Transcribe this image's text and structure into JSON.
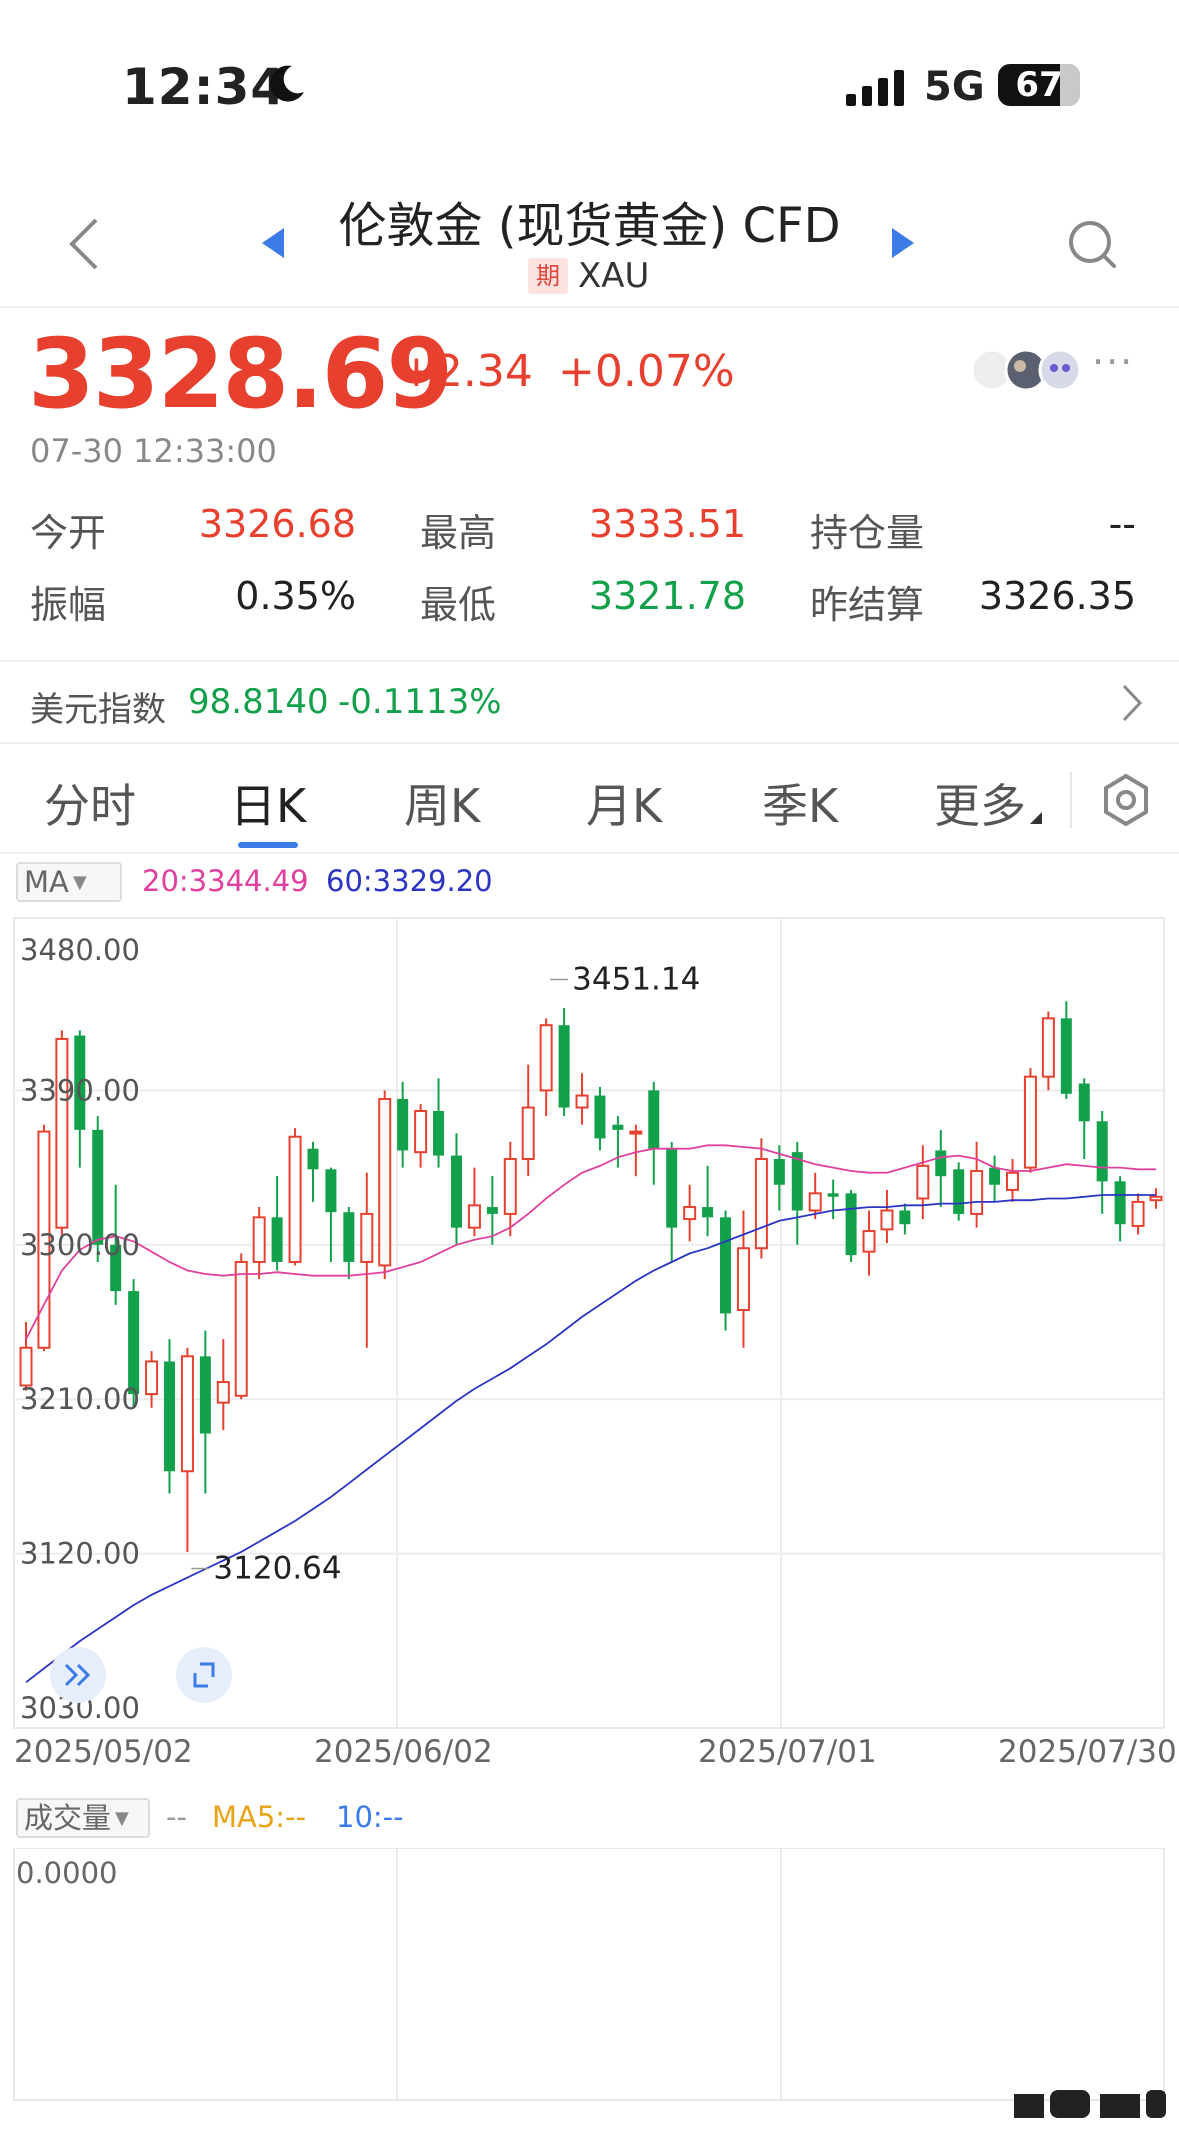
{
  "status_bar": {
    "time": "12:34",
    "network": "5G",
    "battery": "67"
  },
  "header": {
    "title": "伦敦金 (现货黄金) CFD",
    "badge": "期",
    "code": "XAU"
  },
  "quote": {
    "price": "3328.69",
    "change": "+2.34",
    "change_pct": "+0.07%",
    "timestamp": "07-30 12:33:00",
    "fields": [
      {
        "label": "今开",
        "value": "3326.68",
        "color": "#e8402f"
      },
      {
        "label": "最高",
        "value": "3333.51",
        "color": "#e8402f"
      },
      {
        "label": "持仓量",
        "value": "--",
        "color": "#222222"
      },
      {
        "label": "振幅",
        "value": "0.35%",
        "color": "#222222"
      },
      {
        "label": "最低",
        "value": "3321.78",
        "color": "#12a04a"
      },
      {
        "label": "昨结算",
        "value": "3326.35",
        "color": "#222222"
      }
    ]
  },
  "usd_index": {
    "label": "美元指数",
    "value": "98.8140",
    "change": "-0.1113%"
  },
  "tabs": [
    "分时",
    "日K",
    "周K",
    "月K",
    "季K",
    "更多"
  ],
  "active_tab": "日K",
  "indicator": {
    "selector": "MA",
    "ma20": "20:3344.49",
    "ma60": "60:3329.20"
  },
  "chart_data": {
    "type": "candlestick",
    "y_ticks": [
      "3480.00",
      "3390.00",
      "3300.00",
      "3210.00",
      "3120.00",
      "3030.00"
    ],
    "ylim": [
      3030,
      3480
    ],
    "x_ticks": [
      "2025/05/02",
      "2025/06/02",
      "2025/07/01",
      "2025/07/30"
    ],
    "max_label": "3451.14",
    "min_label": "3120.64",
    "candles": [
      {
        "o": 3218,
        "c": 3240,
        "h": 3255,
        "l": 3215
      },
      {
        "o": 3240,
        "c": 3366,
        "h": 3370,
        "l": 3238
      },
      {
        "o": 3310,
        "c": 3420,
        "h": 3425,
        "l": 3305
      },
      {
        "o": 3422,
        "c": 3367,
        "h": 3425,
        "l": 3345
      },
      {
        "o": 3367,
        "c": 3300,
        "h": 3375,
        "l": 3290
      },
      {
        "o": 3300,
        "c": 3273,
        "h": 3335,
        "l": 3265
      },
      {
        "o": 3273,
        "c": 3213,
        "h": 3280,
        "l": 3205
      },
      {
        "o": 3213,
        "c": 3232,
        "h": 3238,
        "l": 3205
      },
      {
        "o": 3232,
        "c": 3168,
        "h": 3245,
        "l": 3155
      },
      {
        "o": 3168,
        "c": 3235,
        "h": 3240,
        "l": 3121
      },
      {
        "o": 3235,
        "c": 3190,
        "h": 3250,
        "l": 3155
      },
      {
        "o": 3208,
        "c": 3220,
        "h": 3245,
        "l": 3192
      },
      {
        "o": 3212,
        "c": 3290,
        "h": 3295,
        "l": 3210
      },
      {
        "o": 3290,
        "c": 3316,
        "h": 3322,
        "l": 3280
      },
      {
        "o": 3316,
        "c": 3290,
        "h": 3340,
        "l": 3285
      },
      {
        "o": 3290,
        "c": 3363,
        "h": 3368,
        "l": 3288
      },
      {
        "o": 3356,
        "c": 3344,
        "h": 3360,
        "l": 3325
      },
      {
        "o": 3344,
        "c": 3319,
        "h": 3345,
        "l": 3290
      },
      {
        "o": 3319,
        "c": 3290,
        "h": 3322,
        "l": 3280
      },
      {
        "o": 3290,
        "c": 3318,
        "h": 3342,
        "l": 3240
      },
      {
        "o": 3288,
        "c": 3385,
        "h": 3390,
        "l": 3280
      },
      {
        "o": 3385,
        "c": 3355,
        "h": 3395,
        "l": 3345
      },
      {
        "o": 3354,
        "c": 3378,
        "h": 3382,
        "l": 3345
      },
      {
        "o": 3378,
        "c": 3352,
        "h": 3397,
        "l": 3345
      },
      {
        "o": 3352,
        "c": 3310,
        "h": 3365,
        "l": 3300
      },
      {
        "o": 3310,
        "c": 3323,
        "h": 3345,
        "l": 3305
      },
      {
        "o": 3322,
        "c": 3318,
        "h": 3340,
        "l": 3300
      },
      {
        "o": 3318,
        "c": 3350,
        "h": 3360,
        "l": 3305
      },
      {
        "o": 3350,
        "c": 3380,
        "h": 3405,
        "l": 3340
      },
      {
        "o": 3390,
        "c": 3428,
        "h": 3432,
        "l": 3375
      },
      {
        "o": 3428,
        "c": 3380,
        "h": 3438,
        "l": 3375
      },
      {
        "o": 3380,
        "c": 3387,
        "h": 3400,
        "l": 3370
      },
      {
        "o": 3387,
        "c": 3362,
        "h": 3392,
        "l": 3355
      },
      {
        "o": 3370,
        "c": 3367,
        "h": 3375,
        "l": 3345
      },
      {
        "o": 3366,
        "c": 3366,
        "h": 3370,
        "l": 3340
      },
      {
        "o": 3390,
        "c": 3356,
        "h": 3395,
        "l": 3335
      },
      {
        "o": 3356,
        "c": 3310,
        "h": 3360,
        "l": 3290
      },
      {
        "o": 3315,
        "c": 3322,
        "h": 3335,
        "l": 3302
      },
      {
        "o": 3322,
        "c": 3316,
        "h": 3346,
        "l": 3305
      },
      {
        "o": 3316,
        "c": 3260,
        "h": 3320,
        "l": 3250
      },
      {
        "o": 3262,
        "c": 3298,
        "h": 3320,
        "l": 3240
      },
      {
        "o": 3298,
        "c": 3350,
        "h": 3362,
        "l": 3292
      },
      {
        "o": 3350,
        "c": 3335,
        "h": 3358,
        "l": 3320
      },
      {
        "o": 3354,
        "c": 3320,
        "h": 3360,
        "l": 3300
      },
      {
        "o": 3320,
        "c": 3330,
        "h": 3342,
        "l": 3315
      },
      {
        "o": 3330,
        "c": 3328,
        "h": 3338,
        "l": 3315
      },
      {
        "o": 3330,
        "c": 3294,
        "h": 3332,
        "l": 3290
      },
      {
        "o": 3296,
        "c": 3308,
        "h": 3320,
        "l": 3282
      },
      {
        "o": 3309,
        "c": 3320,
        "h": 3332,
        "l": 3301
      },
      {
        "o": 3320,
        "c": 3312,
        "h": 3324,
        "l": 3306
      },
      {
        "o": 3327,
        "c": 3346,
        "h": 3358,
        "l": 3315
      },
      {
        "o": 3355,
        "c": 3340,
        "h": 3367,
        "l": 3322
      },
      {
        "o": 3344,
        "c": 3318,
        "h": 3348,
        "l": 3314
      },
      {
        "o": 3318,
        "c": 3343,
        "h": 3360,
        "l": 3310
      },
      {
        "o": 3345,
        "c": 3335,
        "h": 3352,
        "l": 3325
      },
      {
        "o": 3332,
        "c": 3342,
        "h": 3350,
        "l": 3325
      },
      {
        "o": 3345,
        "c": 3398,
        "h": 3403,
        "l": 3342
      },
      {
        "o": 3398,
        "c": 3432,
        "h": 3436,
        "l": 3390
      },
      {
        "o": 3432,
        "c": 3388,
        "h": 3442,
        "l": 3385
      },
      {
        "o": 3394,
        "c": 3372,
        "h": 3397,
        "l": 3350
      },
      {
        "o": 3372,
        "c": 3337,
        "h": 3378,
        "l": 3318
      },
      {
        "o": 3337,
        "c": 3312,
        "h": 3340,
        "l": 3302
      },
      {
        "o": 3311,
        "c": 3325,
        "h": 3330,
        "l": 3306
      },
      {
        "o": 3326,
        "c": 3328,
        "h": 3333,
        "l": 3321
      }
    ],
    "ma20": [
      3245,
      3265,
      3285,
      3297,
      3303,
      3305,
      3302,
      3296,
      3290,
      3285,
      3283,
      3282,
      3283,
      3283,
      3284,
      3283,
      3282,
      3282,
      3282,
      3283,
      3284,
      3287,
      3290,
      3295,
      3300,
      3303,
      3305,
      3310,
      3318,
      3327,
      3335,
      3342,
      3346,
      3351,
      3354,
      3356,
      3356,
      3356,
      3358,
      3358,
      3357,
      3356,
      3353,
      3350,
      3347,
      3345,
      3343,
      3342,
      3342,
      3345,
      3348,
      3351,
      3352,
      3350,
      3345,
      3343,
      3343,
      3345,
      3347,
      3346,
      3345,
      3345,
      3344,
      3344
    ],
    "ma60": [
      3045,
      3053,
      3061,
      3069,
      3076,
      3083,
      3090,
      3096,
      3101,
      3106,
      3111,
      3116,
      3121,
      3127,
      3133,
      3139,
      3146,
      3153,
      3161,
      3169,
      3177,
      3185,
      3193,
      3201,
      3209,
      3216,
      3222,
      3228,
      3235,
      3242,
      3250,
      3258,
      3265,
      3272,
      3279,
      3285,
      3290,
      3295,
      3298,
      3302,
      3306,
      3310,
      3314,
      3316,
      3318,
      3320,
      3321,
      3322,
      3322,
      3323,
      3323,
      3324,
      3324,
      3325,
      3325,
      3326,
      3326,
      3327,
      3327,
      3328,
      3329,
      3329,
      3329,
      3329
    ]
  },
  "volume": {
    "selector": "成交量",
    "value": "--",
    "ma5": "MA5:--",
    "ma10": "10:--",
    "axis_zero": "0.0000"
  },
  "colors": {
    "up": "#e8402f",
    "down": "#12a04a",
    "ma20": "#e0409e",
    "ma60": "#2b35c2",
    "accent": "#3a7be8"
  }
}
